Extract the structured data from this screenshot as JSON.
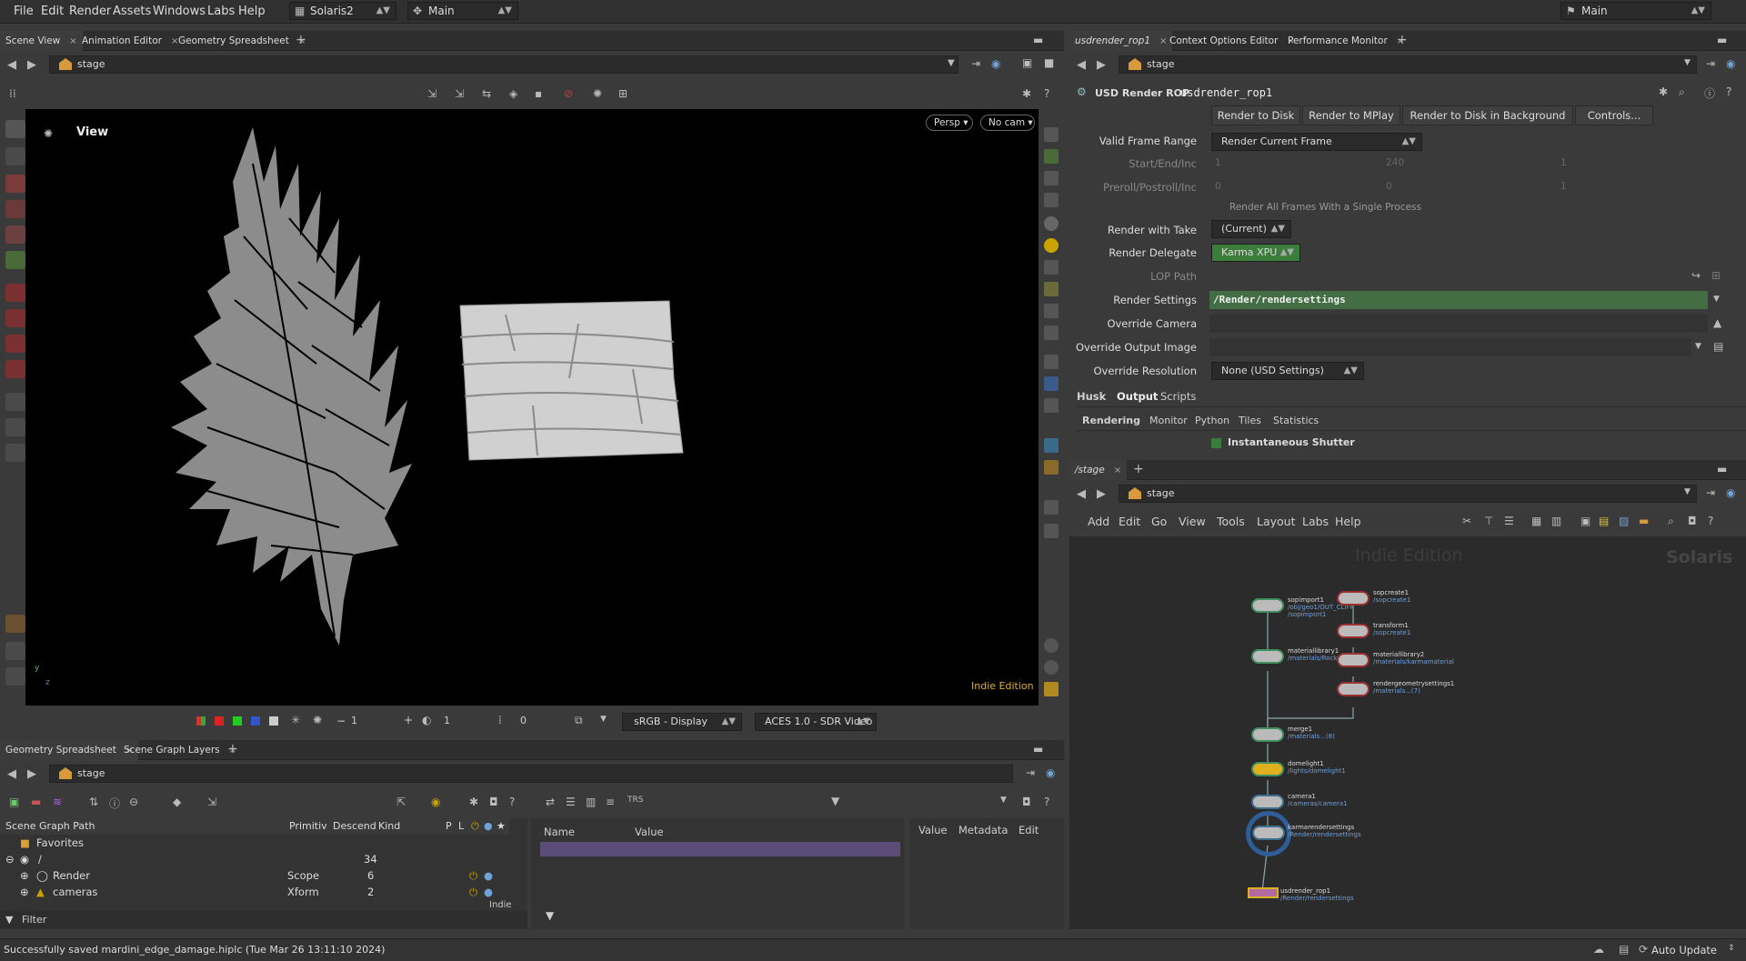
{
  "menu": [
    "File",
    "Edit",
    "Render",
    "Assets",
    "Windows",
    "Labs",
    "Help"
  ],
  "desktop": "Solaris2",
  "scene_context": "Main",
  "right_context": "Main",
  "left_tabs": [
    "Scene View",
    "Animation Editor",
    "Geometry Spreadsheet"
  ],
  "right_tabs": [
    "usdrender_rop1",
    "Context Options Editor",
    "Performance Monitor"
  ],
  "path": "stage",
  "viewport": {
    "title": "View",
    "persp": "Persp",
    "cam": "No cam",
    "watermark": "Indie Edition",
    "axis_y": "y",
    "axis_z": "z"
  },
  "viewbar": {
    "field1": "1",
    "field2": "1",
    "field3": "0",
    "display": "sRGB - Display",
    "view_transform": "ACES 1.0 - SDR Video"
  },
  "rop": {
    "type": "USD Render ROP",
    "name": "usdrender_rop1",
    "buttons": [
      "Render to Disk",
      "Render to MPlay",
      "Render to Disk in Background",
      "Controls..."
    ],
    "valid_frame_range_label": "Valid Frame Range",
    "valid_frame_range": "Render Current Frame",
    "start_label": "Start/End/Inc",
    "start": [
      "1",
      "240",
      "1"
    ],
    "preroll_label": "Preroll/Postroll/Inc",
    "preroll": [
      "0",
      "0",
      "1"
    ],
    "single_process": "Render All Frames With a Single Process",
    "take_label": "Render with Take",
    "take": "(Current)",
    "delegate_label": "Render Delegate",
    "delegate": "Karma XPU",
    "lop_label": "LOP Path",
    "settings_label": "Render Settings",
    "settings": "/Render/rendersettings",
    "cam_label": "Override Camera",
    "img_label": "Override Output Image",
    "res_label": "Override Resolution",
    "res": "None (USD Settings)",
    "tabs": [
      "Husk",
      "Output",
      "Scripts"
    ],
    "subtabs": [
      "Rendering",
      "Monitor",
      "Python",
      "Tiles",
      "Statistics"
    ],
    "shutter": "Instantaneous Shutter"
  },
  "network": {
    "tab": "/stage",
    "menu": [
      "Add",
      "Edit",
      "Go",
      "View",
      "Tools",
      "Layout",
      "Labs",
      "Help"
    ],
    "watermark": "Indie Edition",
    "context": "Solaris",
    "nodes": [
      {
        "name": "sopimport1",
        "sub1": "/obj/geo1/OUT_CLIFF",
        "sub2": "/sopimport1"
      },
      {
        "name": "sopcreate1",
        "sub1": "/sopcreate1",
        "sub2": ""
      },
      {
        "name": "transform1",
        "sub1": "/sopcreate1",
        "sub2": ""
      },
      {
        "name": "materiallibrary1",
        "sub1": "/materials/Rock_MAT",
        "sub2": ""
      },
      {
        "name": "materiallibrary2",
        "sub1": "/materials/karmamaterial",
        "sub2": ""
      },
      {
        "name": "rendergeometrysettings1",
        "sub1": "/materials...(7)",
        "sub2": ""
      },
      {
        "name": "merge1",
        "sub1": "/materials...(8)",
        "sub2": ""
      },
      {
        "name": "domelight1",
        "sub1": "/lights/domelight1",
        "sub2": ""
      },
      {
        "name": "camera1",
        "sub1": "/cameras/camera1",
        "sub2": ""
      },
      {
        "name": "karmarendersettings",
        "sub1": "/Render/rendersettings",
        "sub2": ""
      },
      {
        "name": "usdrender_rop1",
        "sub1": "/Render/rendersettings",
        "sub2": ""
      }
    ]
  },
  "bottom_tabs": [
    "Geometry Spreadsheet",
    "Scene Graph Layers"
  ],
  "scenegraph": {
    "headers": [
      "Scene Graph Path",
      "Primitiv",
      "Descend",
      "Kind",
      "P",
      "L"
    ],
    "favorites": "Favorites",
    "rows": [
      {
        "path": "/",
        "prim": "",
        "desc": "34"
      },
      {
        "path": "Render",
        "prim": "Scope",
        "desc": "6"
      },
      {
        "path": "cameras",
        "prim": "Xform",
        "desc": "2"
      }
    ],
    "filter": "Filter",
    "indie": "Indie"
  },
  "attr_headers": [
    "Name",
    "Value"
  ],
  "meta_headers": [
    "Value",
    "Metadata",
    "Edit"
  ],
  "status": {
    "message": "Successfully saved mardini_edge_damage.hiplc (Tue Mar 26 13:11:10 2024)",
    "update": "Auto Update"
  }
}
